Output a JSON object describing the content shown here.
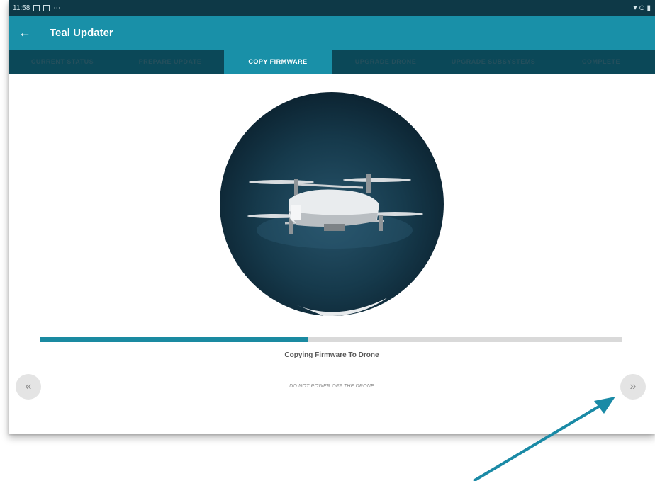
{
  "status_bar": {
    "time": "11:58",
    "right_icons": "▾ ⊙ ▮"
  },
  "app_bar": {
    "back_icon": "←",
    "title": "Teal Updater"
  },
  "tabs": [
    {
      "label": "Current Status",
      "active": false
    },
    {
      "label": "Prepare Update",
      "active": false
    },
    {
      "label": "Copy Firmware",
      "active": true
    },
    {
      "label": "Upgrade Drone",
      "active": false
    },
    {
      "label": "Upgrade Subsystems",
      "active": false
    },
    {
      "label": "Complete",
      "active": false
    }
  ],
  "progress": {
    "percent": 46,
    "label": "Copying Firmware To Drone"
  },
  "warning": "DO NOT POWER OFF THE DRONE",
  "nav": {
    "prev_icon": "«",
    "next_icon": "»"
  },
  "colors": {
    "teal": "#1990a8",
    "dark_teal": "#0b4858",
    "progress": "#1a8aa1"
  }
}
